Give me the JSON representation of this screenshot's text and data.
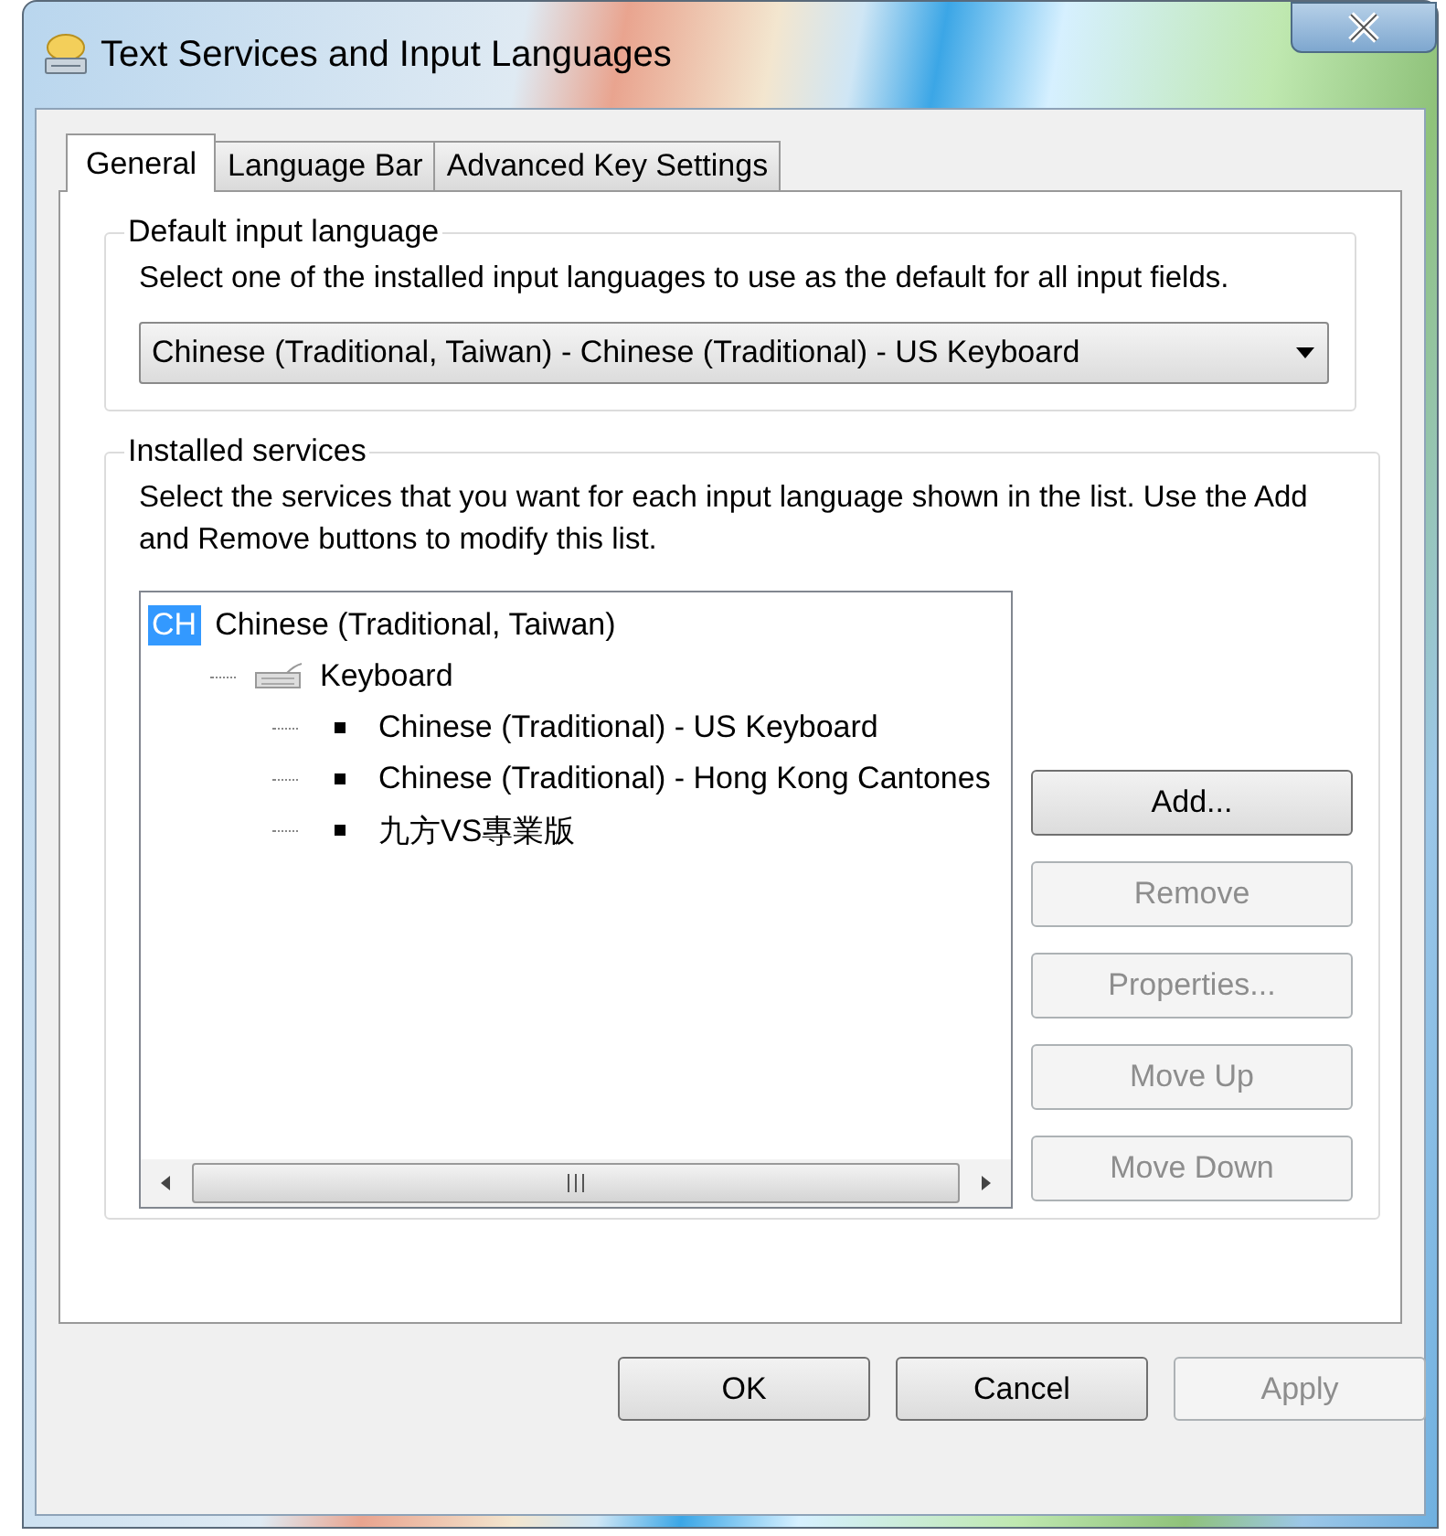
{
  "window": {
    "title": "Text Services and Input Languages"
  },
  "tabs": [
    {
      "label": "General",
      "selected": true
    },
    {
      "label": "Language Bar",
      "selected": false
    },
    {
      "label": "Advanced Key Settings",
      "selected": false
    }
  ],
  "default_input_language": {
    "heading": "Default input language",
    "description": "Select one of the installed input languages to use as the default for all input fields.",
    "dropdown_value": "Chinese (Traditional, Taiwan) - Chinese (Traditional) - US Keyboard"
  },
  "installed_services": {
    "heading": "Installed services",
    "description": "Select the services that you want for each input language shown in the list. Use the Add and Remove buttons to modify this list.",
    "tree": [
      {
        "kind": "language",
        "badge": "CH",
        "label": "Chinese (Traditional, Taiwan)",
        "selected": true,
        "children": [
          {
            "kind": "category",
            "label": "Keyboard",
            "selected": false,
            "children": [
              {
                "kind": "service",
                "label": "Chinese (Traditional) - US Keyboard",
                "selected": false
              },
              {
                "kind": "service",
                "label": "Chinese (Traditional) - Hong Kong Cantones",
                "selected": false
              },
              {
                "kind": "service",
                "label": "九方VS專業版",
                "selected": false
              }
            ]
          }
        ]
      }
    ],
    "buttons": [
      {
        "label": "Add...",
        "disabled": false
      },
      {
        "label": "Remove",
        "disabled": true
      },
      {
        "label": "Properties...",
        "disabled": true
      },
      {
        "label": "Move Up",
        "disabled": true
      },
      {
        "label": "Move Down",
        "disabled": true
      }
    ]
  },
  "footer_buttons": [
    {
      "label": "OK",
      "disabled": false
    },
    {
      "label": "Cancel",
      "disabled": false
    },
    {
      "label": "Apply",
      "disabled": true
    }
  ]
}
